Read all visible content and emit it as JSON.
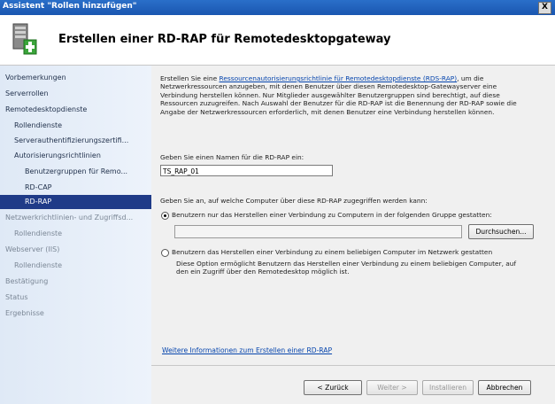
{
  "window": {
    "title": "Assistent \"Rollen hinzufügen\"",
    "close_label": "X"
  },
  "header": {
    "title": "Erstellen einer RD-RAP für Remotedesktopgateway"
  },
  "sidebar": {
    "items": [
      {
        "label": "Vorbemerkungen"
      },
      {
        "label": "Serverrollen"
      },
      {
        "label": "Remotedesktopdienste"
      },
      {
        "label": "Rollendienste"
      },
      {
        "label": "Serverauthentifizierungszertifi..."
      },
      {
        "label": "Autorisierungsrichtlinien"
      },
      {
        "label": "Benutzergruppen für Remo..."
      },
      {
        "label": "RD-CAP"
      },
      {
        "label": "RD-RAP"
      },
      {
        "label": "Netzwerkrichtlinien- und Zugriffsd..."
      },
      {
        "label": "Rollendienste"
      },
      {
        "label": "Webserver (IIS)"
      },
      {
        "label": "Rollendienste"
      },
      {
        "label": "Bestätigung"
      },
      {
        "label": "Status"
      },
      {
        "label": "Ergebnisse"
      }
    ]
  },
  "main": {
    "intro_before": "Erstellen Sie eine ",
    "intro_link": "Ressourcenautorisierungsrichtlinie für Remotedesktopdienste (RDS-RAP)",
    "intro_after": ", um die Netzwerkressourcen anzugeben, mit denen Benutzer über diesen Remotedesktop-Gatewayserver eine Verbindung herstellen können. Nur Mitglieder ausgewählter Benutzergruppen sind berechtigt, auf diese Ressourcen zuzugreifen. Nach Auswahl der Benutzer für die RD-RAP ist die Benennung der RD-RAP sowie die Angabe der Netzwerkressourcen erforderlich, mit denen Benutzer eine Verbindung herstellen können.",
    "name_label": "Geben Sie einen Namen für die RD-RAP ein:",
    "name_value": "TS_RAP_01",
    "computers_label": "Geben Sie an, auf welche Computer über diese RD-RAP zugegriffen werden kann:",
    "option1_label": "Benutzern nur das Herstellen einer Verbindung zu Computern in der folgenden Gruppe gestatten:",
    "group_value": "",
    "browse_label": "Durchsuchen...",
    "option2_label": "Benutzern das Herstellen einer Verbindung zu einem beliebigen Computer im Netzwerk gestatten",
    "option2_desc": "Diese Option ermöglicht Benutzern das Herstellen einer Verbindung zu einem beliebigen Computer, auf den ein Zugriff über den Remotedesktop möglich ist.",
    "more_info_link": "Weitere Informationen zum Erstellen einer RD-RAP"
  },
  "buttons": {
    "back": "< Zurück",
    "next": "Weiter >",
    "install": "Installieren",
    "cancel": "Abbrechen"
  }
}
